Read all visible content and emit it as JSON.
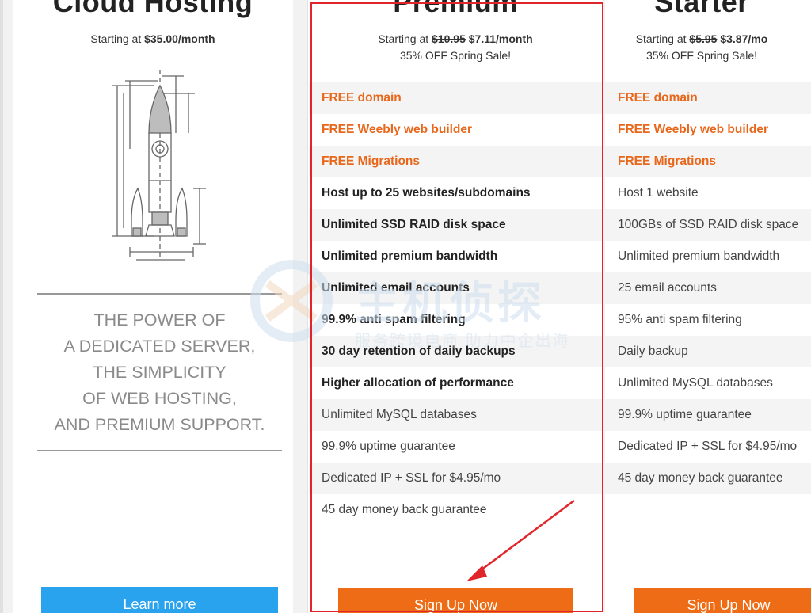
{
  "cloud": {
    "name": "Cloud Hosting",
    "price_prefix": "Starting at ",
    "price": "$35.00/month",
    "tagline": [
      "THE POWER OF",
      "A DEDICATED SERVER,",
      "THE SIMPLICITY",
      "OF WEB HOSTING,",
      "AND PREMIUM SUPPORT."
    ],
    "button": "Learn more"
  },
  "premium": {
    "name": "Premium",
    "price_prefix": "Starting at ",
    "old_price": "$10.95",
    "price": "$7.11/month",
    "sale": "35% OFF Spring Sale!",
    "features": [
      "FREE domain",
      "FREE Weebly web builder",
      "FREE Migrations",
      "Host up to 25 websites/subdomains",
      "Unlimited SSD RAID disk space",
      "Unlimited premium bandwidth",
      "Unlimited email accounts",
      "99.9% anti spam filtering",
      "30 day retention of daily backups",
      "Higher allocation of performance",
      "Unlimited MySQL databases",
      "99.9% uptime guarantee",
      "Dedicated IP + SSL for $4.95/mo",
      "45 day money back guarantee"
    ],
    "button": "Sign Up Now"
  },
  "starter": {
    "name": "Starter",
    "price_prefix": "Starting at ",
    "old_price": "$5.95",
    "price": "$3.87/mo",
    "sale": "35% OFF Spring Sale!",
    "features": [
      "FREE domain",
      "FREE Weebly web builder",
      "FREE Migrations",
      "Host 1 website",
      "100GBs of SSD RAID disk space",
      "Unlimited premium bandwidth",
      "25 email accounts",
      "95% anti spam filtering",
      "Daily backup",
      "Unlimited MySQL databases",
      "99.9% uptime guarantee",
      "Dedicated IP + SSL for $4.95/mo",
      "45 day money back guarantee"
    ],
    "button": "Sign Up Now"
  },
  "watermark": {
    "title": "主机侦探",
    "subtitle": "服务跨境电商 助力中企出海"
  },
  "colors": {
    "orange": "#e8671b",
    "button_orange": "#ed6c15",
    "button_blue": "#2aa3ee",
    "highlight_red": "#e0262b"
  }
}
